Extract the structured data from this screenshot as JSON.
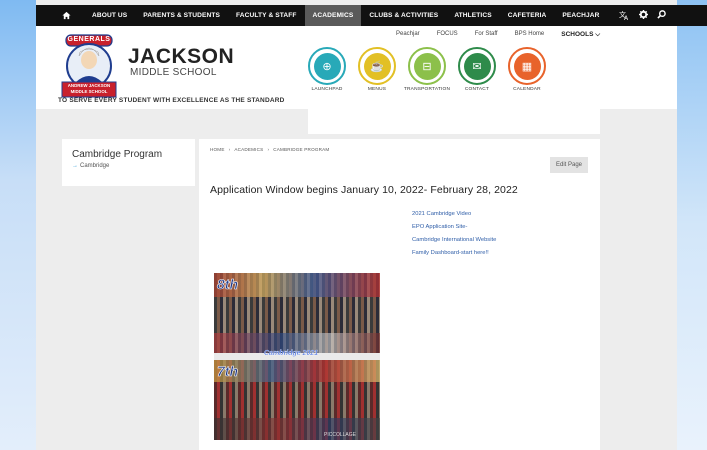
{
  "nav": {
    "items": [
      {
        "label": "ABOUT US",
        "active": false
      },
      {
        "label": "PARENTS & STUDENTS",
        "active": false
      },
      {
        "label": "FACULTY & STAFF",
        "active": false
      },
      {
        "label": "ACADEMICS",
        "active": true
      },
      {
        "label": "CLUBS & ACTIVITIES",
        "active": false
      },
      {
        "label": "ATHLETICS",
        "active": false
      },
      {
        "label": "CAFETERIA",
        "active": false
      },
      {
        "label": "PEACHJAR",
        "active": false
      }
    ],
    "home_icon": "home-icon",
    "tool_icons": [
      "translate-icon",
      "settings-icon",
      "search-icon"
    ]
  },
  "header": {
    "school_name": "JACKSON",
    "school_sub": "MIDDLE SCHOOL",
    "tagline": "TO SERVE EVERY STUDENT WITH EXCELLENCE AS THE STANDARD",
    "logo_top": "GENERALS",
    "logo_banner_1": "ANDREW JACKSON",
    "logo_banner_2": "MIDDLE SCHOOL",
    "util_links": [
      "Peachjar",
      "FOCUS",
      "For Staff",
      "BPS Home"
    ],
    "schools_label": "SCHOOLS ⌵"
  },
  "quick_links": [
    {
      "label": "LAUNCHPAD",
      "color": "#28a9b8",
      "icon": "globe-icon",
      "glyph": "⊕"
    },
    {
      "label": "MENUS",
      "color": "#e2c025",
      "icon": "food-icon",
      "glyph": "☕"
    },
    {
      "label": "TRANSPORTATION",
      "color": "#8cc04a",
      "icon": "bus-icon",
      "glyph": "⊟"
    },
    {
      "label": "CONTACT",
      "color": "#2e8b4a",
      "icon": "mail-icon",
      "glyph": "✉"
    },
    {
      "label": "CALENDAR",
      "color": "#e8632b",
      "icon": "calendar-icon",
      "glyph": "▦"
    }
  ],
  "sidebar": {
    "title": "Cambridge Program",
    "sub_item": "Cambridge"
  },
  "content": {
    "breadcrumbs": [
      "HOME",
      "›",
      "ACADEMICS",
      "›",
      "CAMBRIDGE PROGRAM"
    ],
    "edit_label": "Edit Page",
    "headline": "Application Window begins January 10, 2022- February 28, 2022",
    "links": [
      "2021 Cambridge Video",
      "EPO Application Site-",
      "Cambridge International Website",
      "Family Dashboard-start here!!"
    ],
    "photo": {
      "label_top": "8th",
      "banner": "Cambridge 2021",
      "label_bottom": "7th",
      "watermark": "PICCOLLAGE"
    }
  }
}
